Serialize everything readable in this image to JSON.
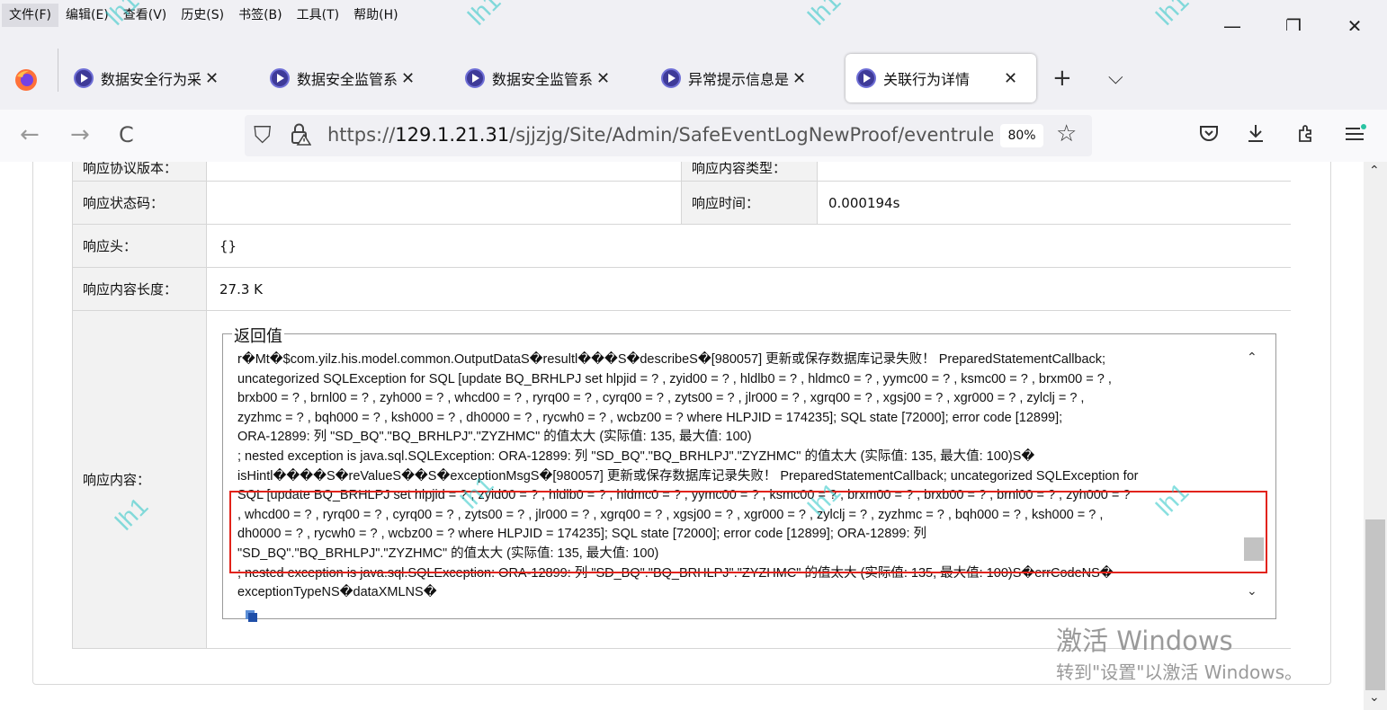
{
  "menubar": {
    "items": [
      "文件(F)",
      "编辑(E)",
      "查看(V)",
      "历史(S)",
      "书签(B)",
      "工具(T)",
      "帮助(H)"
    ]
  },
  "window_controls": {
    "minimize": "—",
    "restore": "❐",
    "close": "✕"
  },
  "tabs": [
    {
      "title": "数据安全行为采",
      "close": "✕"
    },
    {
      "title": "数据安全监管系",
      "close": "✕"
    },
    {
      "title": "数据安全监管系",
      "close": "✕"
    },
    {
      "title": "异常提示信息是",
      "close": "✕"
    },
    {
      "title": "关联行为详情",
      "close": "✕",
      "active": true
    }
  ],
  "tabbar": {
    "new_tab": "+",
    "list_all": "⌵"
  },
  "nav": {
    "back": "←",
    "forward": "→",
    "reload": "C",
    "url_prefix": "https://",
    "url_host": "129.1.21.31",
    "url_path": "/sjjzjg/Site/Admin/SafeEventLogNewProof/eventrule_r",
    "zoom": "80%",
    "star": "☆"
  },
  "details": {
    "cut_row_label_left": "响应协议版本：",
    "cut_row_label_right": "响应内容类型：",
    "status_code_label": "响应状态码：",
    "status_code_value": "",
    "response_time_label": "响应时间：",
    "response_time_value": "0.000194s",
    "headers_label": "响应头：",
    "headers_value": "{}",
    "length_label": "响应内容长度：",
    "length_value": "27.3 K",
    "content_label": "响应内容：",
    "return_legend": "返回值"
  },
  "response_lines": [
    "r�Mt�$com.yilz.his.model.common.OutputDataS�resultl���S�describeS�[980057] 更新或保存数据库记录失败！ PreparedStatementCallback;",
    "uncategorized SQLException for SQL [update BQ_BRHLPJ set  hlpjid = ? , zyid00 = ? , hldlb0 = ? , hldmc0 = ? , yymc00 = ? , ksmc00 = ? , brxm00 = ? ,",
    "brxb00 = ? , brnl00 = ? , zyh000 = ? , whcd00 = ? , ryrq00 = ? , cyrq00 = ? , zyts00 = ? , jlr000 = ? , xgrq00 = ? , xgsj00 = ? , xgr000 = ? , zylclj = ? ,",
    "zyzhmc = ? , bqh000 = ? , ksh000 = ? , dh0000 = ? , rycwh0 = ? , wcbz00 = ? where HLPJID = 174235]; SQL state [72000]; error code [12899];",
    "ORA-12899: 列 \"SD_BQ\".\"BQ_BRHLPJ\".\"ZYZHMC\" 的值太大 (实际值: 135, 最大值: 100)",
    "; nested exception is java.sql.SQLException: ORA-12899: 列 \"SD_BQ\".\"BQ_BRHLPJ\".\"ZYZHMC\" 的值太大 (实际值: 135, 最大值: 100)S�",
    "isHintl����S�reValueS��S�exceptionMsgS�[980057] 更新或保存数据库记录失败！ PreparedStatementCallback; uncategorized SQLException for",
    "SQL [update BQ_BRHLPJ set  hlpjid = ? , zyid00 = ? , hldlb0 = ? , hldmc0 = ? , yymc00 = ? , ksmc00 = ? , brxm00 = ? , brxb00 = ? , brnl00 = ? , zyh000 = ?",
    ", whcd00 = ? , ryrq00 = ? , cyrq00 = ? , zyts00 = ? , jlr000 = ? , xgrq00 = ? , xgsj00 = ? , xgr000 = ? , zylclj = ? , zyzhmc = ? , bqh000 = ? , ksh000 = ? ,",
    "dh0000 = ? , rycwh0 = ? , wcbz00 = ? where HLPJID = 174235]; SQL state [72000]; error code [12899]; ORA-12899: 列",
    "\"SD_BQ\".\"BQ_BRHLPJ\".\"ZYZHMC\" 的值太大 (实际值: 135, 最大值: 100)",
    "; nested exception is java.sql.SQLException: ORA-12899: 列 \"SD_BQ\".\"BQ_BRHLPJ\".\"ZYZHMC\" 的值太大 (实际值: 135, 最大值: 100)S�errCodeNS�",
    "exceptionTypeNS�dataXMLNS�"
  ],
  "watermark_text": "lh1",
  "activation": {
    "line1": "激活 Windows",
    "line2": "转到\"设置\"以激活 Windows。"
  }
}
